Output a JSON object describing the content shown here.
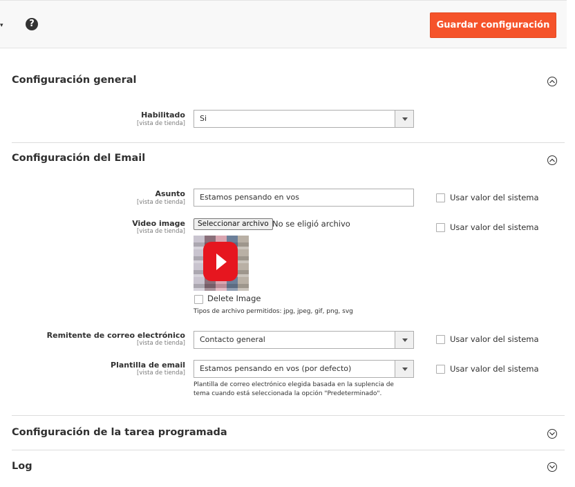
{
  "header": {
    "help_icon": "?",
    "save_label": "Guardar configuración",
    "brand_color": "#f5532a"
  },
  "sections": {
    "general": {
      "title": "Configuración general",
      "enabled": {
        "label": "Habilitado",
        "scope": "[vista de tienda]",
        "value": "Si"
      }
    },
    "email": {
      "title": "Configuración del Email",
      "subject": {
        "label": "Asunto",
        "scope": "[vista de tienda]",
        "value": "Estamos pensando en vos",
        "use_system": "Usar valor del sistema"
      },
      "video_image": {
        "label": "Video image",
        "scope": "[vista de tienda]",
        "file_button": "Seleccionar archivo",
        "file_status": "No se eligió archivo",
        "use_system": "Usar valor del sistema",
        "delete_label": "Delete Image",
        "allowed_types": "Tipos de archivo permitidos: jpg, jpeg, gif, png, svg"
      },
      "sender": {
        "label": "Remitente de correo electrónico",
        "scope": "[vista de tienda]",
        "value": "Contacto general",
        "use_system": "Usar valor del sistema"
      },
      "template": {
        "label": "Plantilla de email",
        "scope": "[vista de tienda]",
        "value": "Estamos pensando en vos (por defecto)",
        "use_system": "Usar valor del sistema",
        "note_line1": "Plantilla de correo electrónico elegida basada en la suplencia de",
        "note_line2": "tema cuando está seleccionada la opción \"Predeterminado\"."
      }
    },
    "cron": {
      "title": "Configuración de la tarea programada"
    },
    "log": {
      "title": "Log"
    }
  }
}
